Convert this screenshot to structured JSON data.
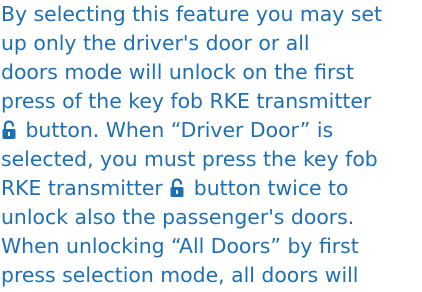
{
  "text": {
    "line_1": "By selecting this feature you may set",
    "line_2": "up only the driver's door or all",
    "line_3": "doors mode will unlock on the first",
    "line_4": "press of the key fob RKE transmitter",
    "line_5_after_icon": " button. When “Driver Door” is",
    "line_6": "selected, you must press the key fob",
    "line_7_before_icon": "RKE transmitter ",
    "line_7_after_icon": " button twice to",
    "line_8": "unlock also the passenger's doors.",
    "line_9": "When unlocking “All Doors” by first",
    "line_10": "press selection mode, all doors will"
  },
  "icons": {
    "unlock": "unlock-icon"
  },
  "colors": {
    "text": "#1f6fb3",
    "background": "#ffffff"
  }
}
